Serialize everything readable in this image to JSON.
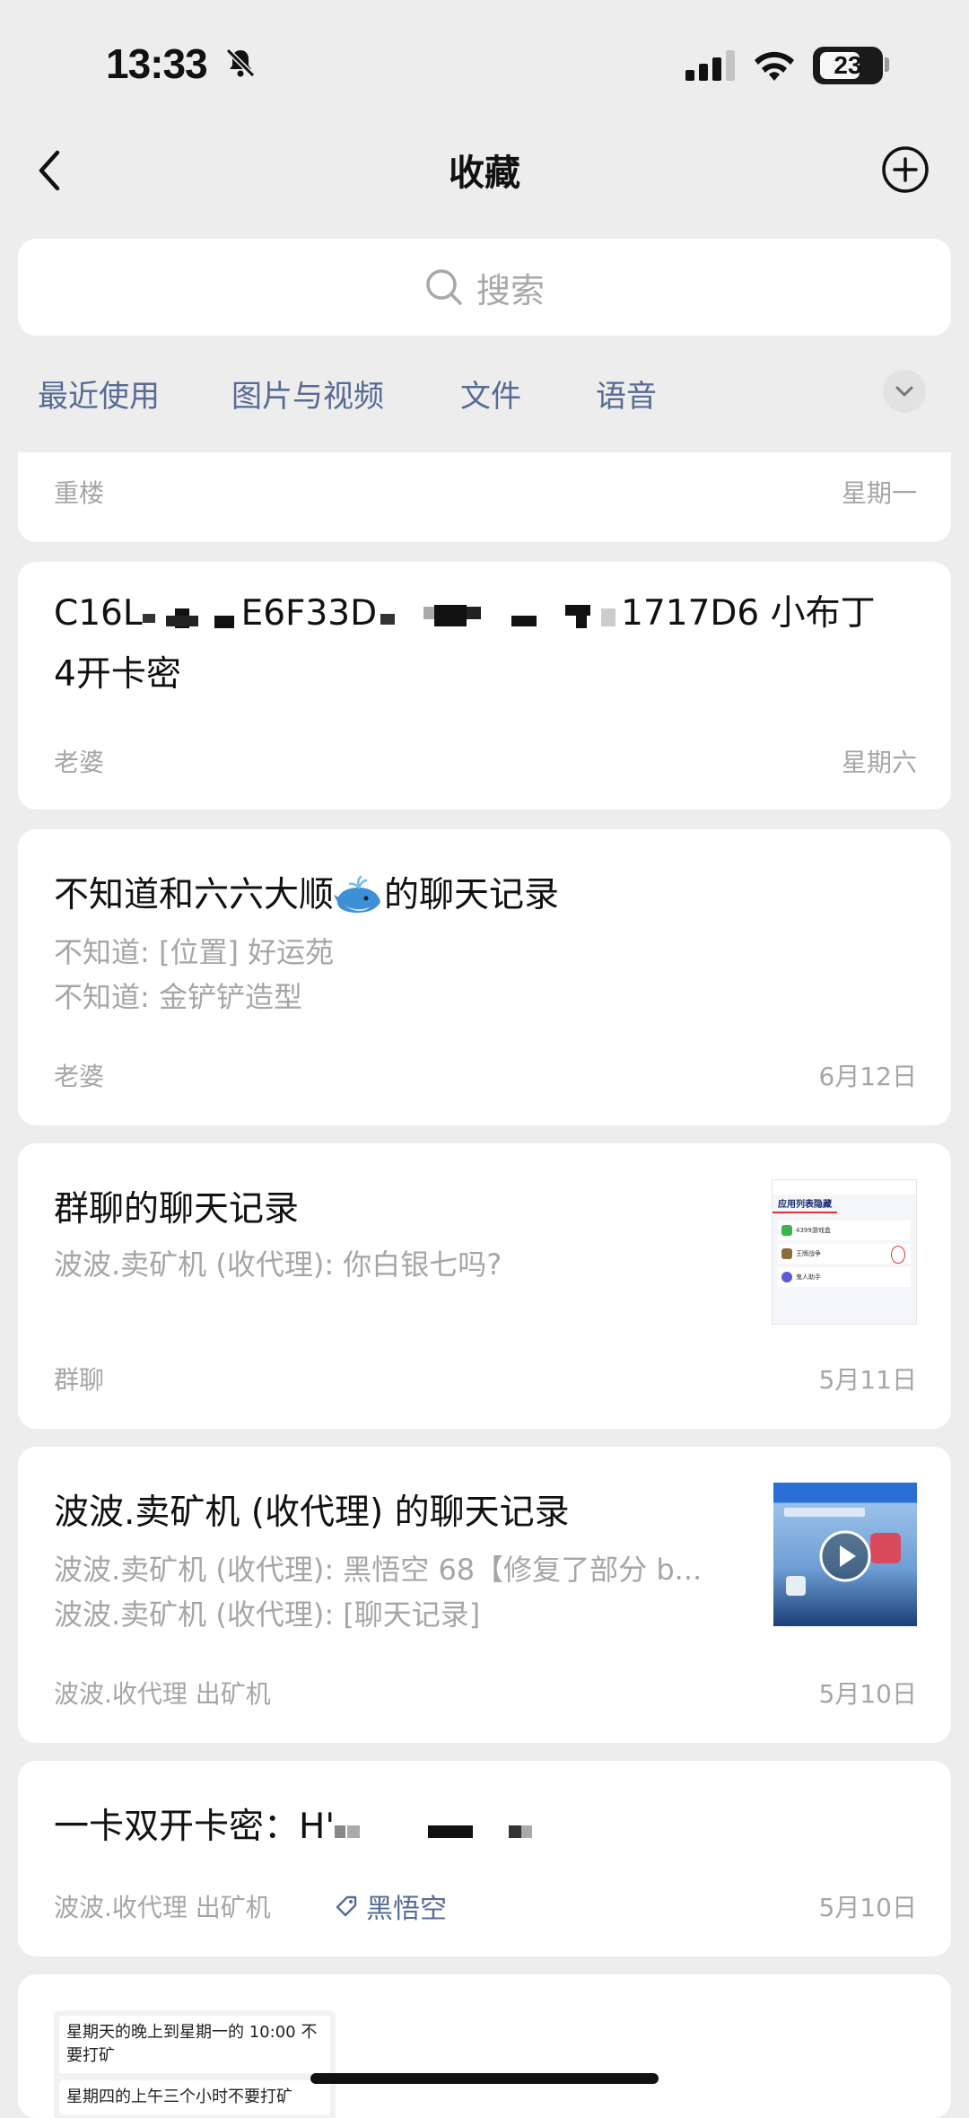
{
  "status_bar": {
    "time": "13:33",
    "battery": "23"
  },
  "nav": {
    "title": "收藏"
  },
  "search": {
    "placeholder": "搜索"
  },
  "tabs": [
    {
      "label": "最近使用"
    },
    {
      "label": "图片与视频"
    },
    {
      "label": "文件"
    },
    {
      "label": "语音"
    }
  ],
  "items": [
    {
      "title": "",
      "source": "重楼",
      "date": "星期一"
    },
    {
      "title_part1": "C16L",
      "title_part2": "E6F33D",
      "title_part3": "1717D6 小布丁",
      "title_line2": "4开卡密",
      "source": "老婆",
      "date": "星期六"
    },
    {
      "title_a": "不知道和六六大顺",
      "title_b": "的聊天记录",
      "lines": [
        "不知道: [位置] 好运苑",
        "不知道: 金铲铲造型"
      ],
      "source": "老婆",
      "date": "6月12日"
    },
    {
      "title": "群聊的聊天记录",
      "lines": [
        "波波.卖矿机 (收代理): 你白银七吗?"
      ],
      "source": "群聊",
      "date": "5月11日",
      "thumb": {
        "header": "应用列表隐藏",
        "rows": [
          "4399游戏盒",
          "王牌战争",
          "鬼人助手"
        ]
      }
    },
    {
      "title": "波波.卖矿机 (收代理) 的聊天记录",
      "lines": [
        "波波.卖矿机 (收代理): 黑悟空 68【修复了部分 b...",
        "波波.卖矿机 (收代理): [聊天记录]"
      ],
      "source": "波波.收代理 出矿机",
      "date": "5月10日"
    },
    {
      "title": "一卡双开卡密：H'",
      "source": "波波.收代理 出矿机",
      "tag": "黑悟空",
      "date": "5月10日"
    },
    {
      "note_lines": [
        "星期天的晚上到星期一的 10:00 不要打矿",
        "星期四的上午三个小时不要打矿"
      ]
    }
  ],
  "colors": {
    "link": "#576b95",
    "background": "#ededed",
    "muted": "#a6a6a6"
  }
}
